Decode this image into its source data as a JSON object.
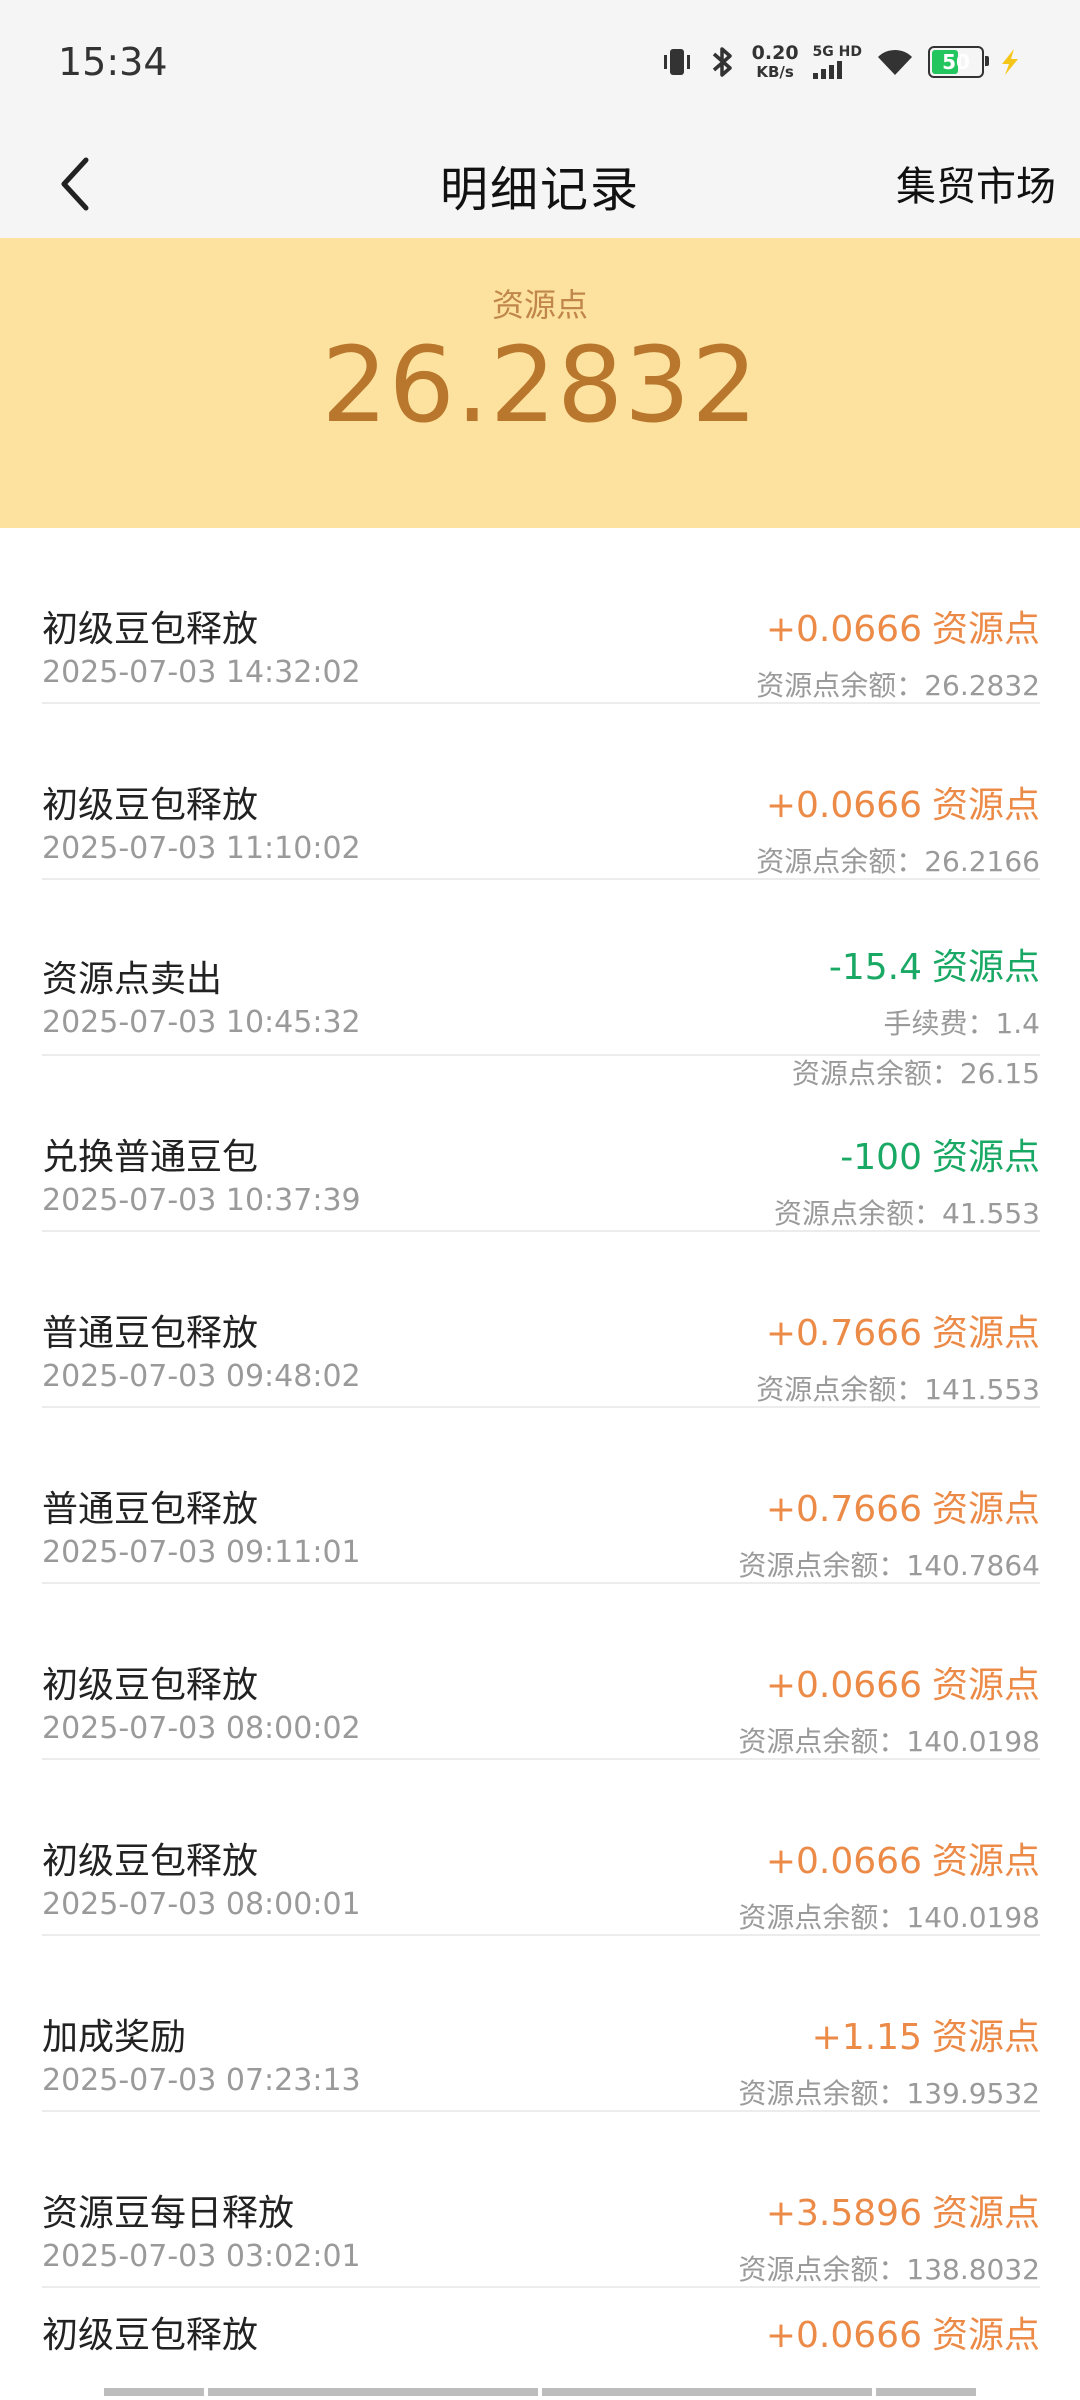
{
  "status_bar": {
    "time": "15:34",
    "speed_value": "0.20",
    "speed_unit": "KB/s",
    "network": "5G HD",
    "battery": "50",
    "battery_level": 0.5,
    "accent_battery": "#22c55e"
  },
  "nav": {
    "title": "明细记录",
    "action": "集贸市场",
    "back_icon": "chevron-left-icon"
  },
  "balance": {
    "label": "资源点",
    "value": "26.2832",
    "bg_color": "#fde29f",
    "text_color": "#b8772c"
  },
  "records": [
    {
      "title": "初级豆包释放",
      "time": "2025-07-03 14:32:02",
      "amount": "+0.0666",
      "unit": "资源点",
      "type": "plus",
      "balance": "资源点余额：26.2832"
    },
    {
      "title": "初级豆包释放",
      "time": "2025-07-03 11:10:02",
      "amount": "+0.0666",
      "unit": "资源点",
      "type": "plus",
      "balance": "资源点余额：26.2166"
    },
    {
      "title": "资源点卖出",
      "time": "2025-07-03 10:45:32",
      "amount": "-15.4",
      "unit": "资源点",
      "type": "minus",
      "fee": "手续费：1.4",
      "balance": "资源点余额：26.15"
    },
    {
      "title": "兑换普通豆包",
      "time": "2025-07-03 10:37:39",
      "amount": "-100",
      "unit": "资源点",
      "type": "minus",
      "balance": "资源点余额：41.553"
    },
    {
      "title": "普通豆包释放",
      "time": "2025-07-03 09:48:02",
      "amount": "+0.7666",
      "unit": "资源点",
      "type": "plus",
      "balance": "资源点余额：141.553"
    },
    {
      "title": "普通豆包释放",
      "time": "2025-07-03 09:11:01",
      "amount": "+0.7666",
      "unit": "资源点",
      "type": "plus",
      "balance": "资源点余额：140.7864"
    },
    {
      "title": "初级豆包释放",
      "time": "2025-07-03 08:00:02",
      "amount": "+0.0666",
      "unit": "资源点",
      "type": "plus",
      "balance": "资源点余额：140.0198"
    },
    {
      "title": "初级豆包释放",
      "time": "2025-07-03 08:00:01",
      "amount": "+0.0666",
      "unit": "资源点",
      "type": "plus",
      "balance": "资源点余额：140.0198"
    },
    {
      "title": "加成奖励",
      "time": "2025-07-03 07:23:13",
      "amount": "+1.15",
      "unit": "资源点",
      "type": "plus",
      "balance": "资源点余额：139.9532"
    },
    {
      "title": "资源豆每日释放",
      "time": "2025-07-03 03:02:01",
      "amount": "+3.5896",
      "unit": "资源点",
      "type": "plus",
      "balance": "资源点余额：138.8032"
    },
    {
      "title": "初级豆包释放",
      "amount": "+0.0666",
      "unit": "资源点",
      "type": "plus"
    }
  ],
  "colors": {
    "plus": "#ec8a47",
    "minus": "#1aa865"
  }
}
